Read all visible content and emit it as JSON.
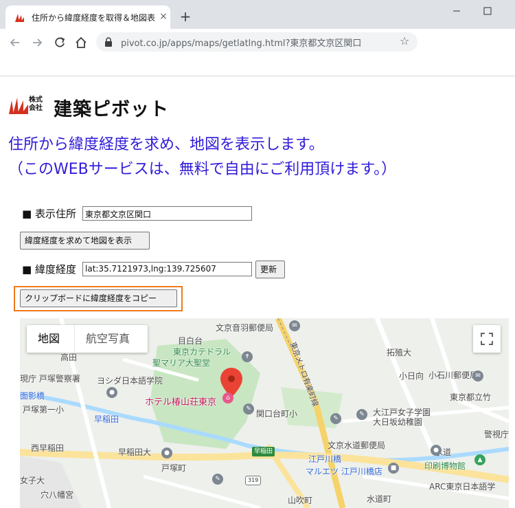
{
  "browser": {
    "tab_title": "住所から緯度経度を取得＆地図表",
    "tab_close": "×",
    "new_tab": "+",
    "url": "pivot.co.jp/apps/maps/getlatlng.html?東京都文京区関口",
    "star": "☆"
  },
  "logo": {
    "kaisha_line1": "株式",
    "kaisha_line2": "会社",
    "name": "建築ピボット"
  },
  "headline": {
    "line1": "住所から緯度経度を求め、地図を表示します。",
    "line2": "（このWEBサービスは、無料で自由にご利用頂けます。）"
  },
  "form": {
    "address_label": "■ 表示住所",
    "address_value": "東京都文京区関口",
    "search_button": "緯度経度を求めて地図を表示",
    "latlng_label": "■ 緯度経度",
    "latlng_value": "lat:35.7121973,lng:139.725607",
    "update_button": "更新",
    "copy_button": "クリップボードに緯度経度をコピー"
  },
  "map": {
    "type_map": "地図",
    "type_satellite": "航空写真",
    "marker_label": "ホテル椿山荘東京",
    "labels": [
      {
        "text": "文京音羽郵便局",
        "cls": ""
      },
      {
        "text": "目白台",
        "cls": ""
      },
      {
        "text": "東京カテドラル",
        "cls": "green"
      },
      {
        "text": "聖マリア大聖堂",
        "cls": "green"
      },
      {
        "text": "拓殖大",
        "cls": ""
      },
      {
        "text": "高田",
        "cls": ""
      },
      {
        "text": "小日向",
        "cls": ""
      },
      {
        "text": "小石川郵便局",
        "cls": ""
      },
      {
        "text": "現庁 戸塚警察署",
        "cls": ""
      },
      {
        "text": "ヨシダ日本語学院",
        "cls": ""
      },
      {
        "text": "東京都立竹",
        "cls": ""
      },
      {
        "text": "面影橋",
        "cls": ""
      },
      {
        "text": "戸塚第一小",
        "cls": ""
      },
      {
        "text": "早稲田",
        "cls": "blue"
      },
      {
        "text": "関口台町小",
        "cls": ""
      },
      {
        "text": "大日坂幼稚園",
        "cls": ""
      },
      {
        "text": "大江戸女子学園",
        "cls": ""
      },
      {
        "text": "警視庁",
        "cls": ""
      },
      {
        "text": "西早稲田",
        "cls": ""
      },
      {
        "text": "文京水道郵便局",
        "cls": ""
      },
      {
        "text": "早稲田大",
        "cls": ""
      },
      {
        "text": "江戸川橋",
        "cls": "blue"
      },
      {
        "text": "水道",
        "cls": ""
      },
      {
        "text": "印刷博物館",
        "cls": "green"
      },
      {
        "text": "マルエツ 江戸川橋店",
        "cls": "blue"
      },
      {
        "text": "戸塚町",
        "cls": ""
      },
      {
        "text": "女子大",
        "cls": ""
      },
      {
        "text": "穴八幡宮",
        "cls": ""
      },
      {
        "text": "山吹町",
        "cls": ""
      },
      {
        "text": "水道町",
        "cls": ""
      },
      {
        "text": "ARC東京日本語学",
        "cls": ""
      },
      {
        "text": "東京メトロ有楽町線",
        "cls": ""
      }
    ],
    "station_label": "早稲田",
    "route_label": "319"
  }
}
